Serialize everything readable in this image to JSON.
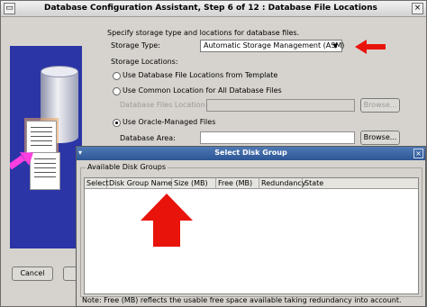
{
  "window": {
    "title": "Database Configuration Assistant, Step 6 of 12 : Database File Locations",
    "close_glyph": "×",
    "menu_glyph": "▭"
  },
  "form": {
    "intro": "Specify storage type and locations for database files.",
    "storage_type_label": "Storage Type:",
    "storage_type_value": "Automatic Storage Management (ASM)",
    "storage_locations_label": "Storage Locations:",
    "options": [
      {
        "label": "Use Database File Locations from Template",
        "selected": false
      },
      {
        "label": "Use Common Location for All Database Files",
        "selected": false
      },
      {
        "label": "Use Oracle-Managed Files",
        "selected": true
      }
    ],
    "database_files_location_label": "Database Files Location:",
    "database_files_location_value": "",
    "database_area_label": "Database Area:",
    "database_area_value": "",
    "browse_label": "Browse..."
  },
  "footer": {
    "cancel_label": "Cancel"
  },
  "dialog": {
    "title": "Select Disk Group",
    "close_glyph": "×",
    "menu_glyph": "▾",
    "group_label": "Available Disk Groups",
    "columns": [
      "Select",
      "Disk Group Name",
      "Size (MB)",
      "Free (MB)",
      "Redundancy",
      "State"
    ],
    "rows": [],
    "note": "Note:  Free (MB) reflects the usable free space available taking redundancy into account."
  },
  "colors": {
    "window_bg": "#d6d3ce",
    "dialog_titlebar": "#2d5795",
    "annotation_arrow": "#e8130b",
    "illustration_bg": "#2b35a6"
  }
}
